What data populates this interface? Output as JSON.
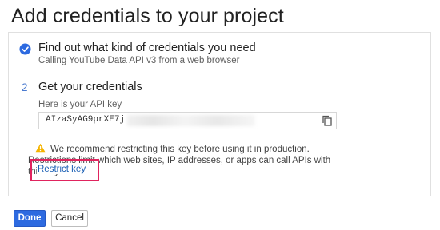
{
  "page": {
    "title": "Add credentials to your project"
  },
  "step1": {
    "title": "Find out what kind of credentials you need",
    "subtitle": "Calling YouTube Data API v3 from a web browser",
    "icon": "check-circle-icon",
    "status_color": "#2d6ae0"
  },
  "step2": {
    "number": "2",
    "title": "Get your credentials",
    "api_key_label": "Here is your API key",
    "api_key_value": "AIzaSyAG9prXE7j",
    "copy_icon": "copy-icon",
    "warning_icon": "warning-icon",
    "warning_color": "#f5b400",
    "warning_text": "We recommend restricting this key before using it in production. Restrictions limit which web sites, IP addresses, or apps can call APIs with this key.",
    "restrict_link": "Restrict key",
    "highlight_color": "#e0245e"
  },
  "actions": {
    "done_label": "Done",
    "cancel_label": "Cancel",
    "accent": "#2d6ae0"
  }
}
